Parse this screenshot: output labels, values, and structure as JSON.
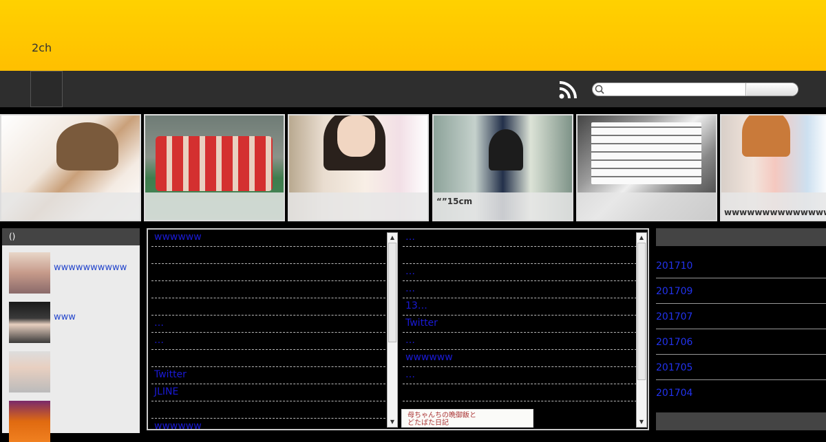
{
  "header": {
    "site_title": "2ch"
  },
  "slider": [
    {
      "caption": ""
    },
    {
      "caption": ""
    },
    {
      "caption": ""
    },
    {
      "caption": "“”15cm"
    },
    {
      "caption": ""
    },
    {
      "caption": "wwwwwwwwwwwwwwwwww"
    }
  ],
  "left_sidebar": {
    "heading": "()",
    "items": [
      {
        "label": "wwwwwwwwww"
      },
      {
        "label": "www"
      },
      {
        "label": ""
      },
      {
        "label": ""
      }
    ]
  },
  "center": {
    "col_a": [
      "wwwwww",
      "",
      "",
      "",
      "",
      "…",
      "…",
      "",
      "Twitter",
      "JLINE",
      "",
      "wwwwww"
    ],
    "col_b": [
      "…",
      "",
      "…",
      "…",
      "13…",
      "Twitter",
      "…",
      "wwwwww",
      "…",
      "",
      ""
    ],
    "banner_text": "母ちゃんちの晩御飯と\nどたばた日記"
  },
  "right_sidebar": {
    "archives": [
      "201710",
      "201709",
      "201707",
      "201706",
      "201705",
      "201704"
    ]
  },
  "colors": {
    "header": "#ffc800",
    "nav": "#2e2e2e",
    "link": "#1a1ad6"
  }
}
